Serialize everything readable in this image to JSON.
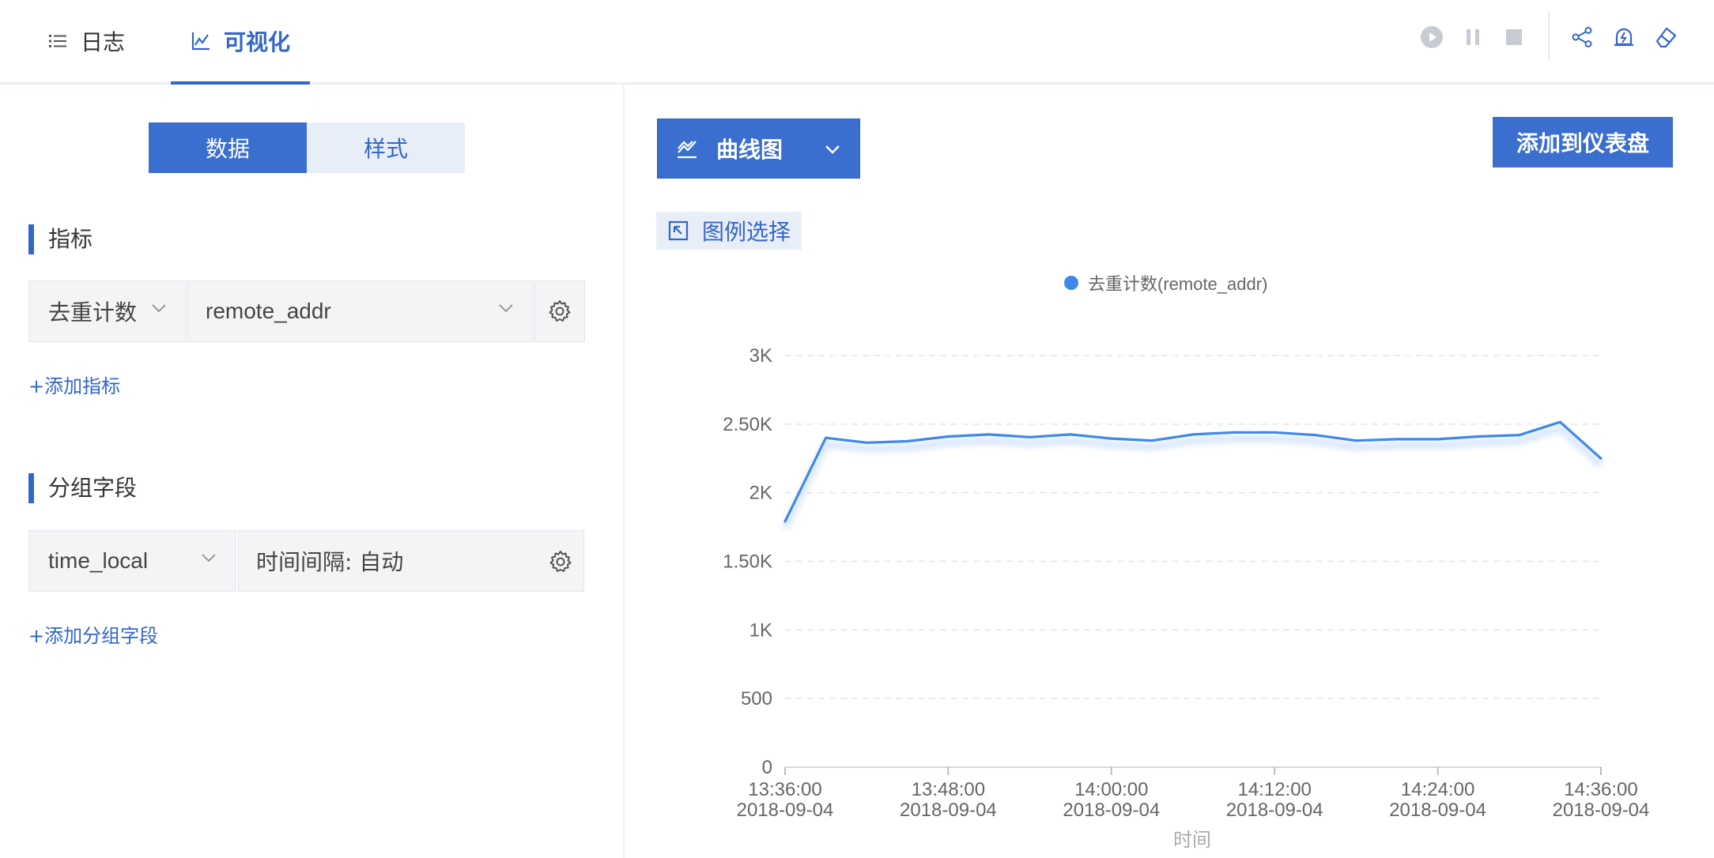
{
  "tabs": {
    "logs": "日志",
    "visualize": "可视化"
  },
  "data_panel": {
    "seg_data": "数据",
    "seg_style": "样式",
    "metrics_title": "指标",
    "metric_agg": "去重计数",
    "metric_field": "remote_addr",
    "add_metric": "+添加指标",
    "group_title": "分组字段",
    "group_field": "time_local",
    "group_interval": "时间间隔: 自动",
    "add_group": "+添加分组字段"
  },
  "chart_controls": {
    "chart_type": "曲线图",
    "add_to_dashboard": "添加到仪表盘",
    "legend_select": "图例选择"
  },
  "colors": {
    "accent": "#3366cc",
    "button": "#3a6ecf",
    "series": "#3d89ea"
  },
  "chart_data": {
    "type": "line",
    "legend": [
      "去重计数(remote_addr)"
    ],
    "xlabel": "时间",
    "ylabel": "",
    "ylim": [
      0,
      3000
    ],
    "y_ticks": [
      {
        "value": 0,
        "label": "0"
      },
      {
        "value": 500,
        "label": "500"
      },
      {
        "value": 1000,
        "label": "1K"
      },
      {
        "value": 1500,
        "label": "1.50K"
      },
      {
        "value": 2000,
        "label": "2K"
      },
      {
        "value": 2500,
        "label": "2.50K"
      },
      {
        "value": 3000,
        "label": "3K"
      }
    ],
    "x_tick_labels": [
      {
        "minute": 0,
        "time": "13:36:00",
        "date": "2018-09-04"
      },
      {
        "minute": 12,
        "time": "13:48:00",
        "date": "2018-09-04"
      },
      {
        "minute": 24,
        "time": "14:00:00",
        "date": "2018-09-04"
      },
      {
        "minute": 36,
        "time": "14:12:00",
        "date": "2018-09-04"
      },
      {
        "minute": 48,
        "time": "14:24:00",
        "date": "2018-09-04"
      },
      {
        "minute": 60,
        "time": "14:36:00",
        "date": "2018-09-04"
      }
    ],
    "grid": true,
    "series": [
      {
        "name": "去重计数(remote_addr)",
        "x": [
          "13:36",
          "13:39",
          "13:42",
          "13:45",
          "13:48",
          "13:51",
          "13:54",
          "13:57",
          "14:00",
          "14:03",
          "14:06",
          "14:09",
          "14:12",
          "14:15",
          "14:18",
          "14:21",
          "14:24",
          "14:27",
          "14:30",
          "14:33",
          "14:36"
        ],
        "values": [
          1790,
          2400,
          2365,
          2375,
          2410,
          2425,
          2405,
          2425,
          2395,
          2380,
          2425,
          2440,
          2440,
          2420,
          2380,
          2390,
          2390,
          2410,
          2420,
          2515,
          2250
        ]
      }
    ]
  }
}
